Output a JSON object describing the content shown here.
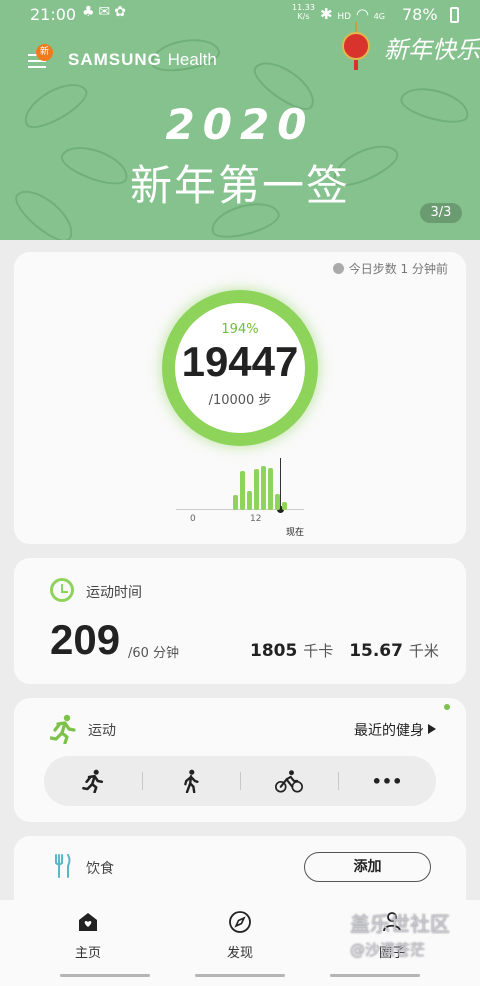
{
  "status": {
    "time": "21:00",
    "speed_top": "11.33",
    "speed_bottom": "K/s",
    "network": "HD",
    "signal": "4G",
    "battery": "78%"
  },
  "header": {
    "menu_badge": "新",
    "brand_bold": "SAMSUNG",
    "brand_light": "Health",
    "greeting": "新年快乐",
    "year": "2020",
    "headline": "新年第一签",
    "pager": "3/3"
  },
  "steps_card": {
    "sync_note": "今日步数 1 分钟前",
    "percent": "194%",
    "steps": "19447",
    "goal": "/10000 步",
    "axis_start": "0",
    "axis_mid": "12",
    "now_label": "现在",
    "hourly_steps_relative": [
      0.0,
      0.0,
      0.0,
      0.0,
      0.0,
      0.0,
      0.0,
      0.32,
      0.85,
      0.42,
      0.9,
      0.95,
      0.92,
      0.35,
      0.18
    ]
  },
  "exercise_card": {
    "title": "运动时间",
    "minutes": "209",
    "goal": "/60 分钟",
    "calories": "1805",
    "calories_unit": "千卡",
    "distance": "15.67",
    "distance_unit": "千米"
  },
  "activity_card": {
    "title": "运动",
    "recent_label": "最近的健身",
    "quick_items": [
      "run-icon",
      "walk-icon",
      "bike-icon",
      "more-icon"
    ],
    "more_label": "•••"
  },
  "food_card": {
    "title": "饮食",
    "add_label": "添加"
  },
  "bottom_nav": {
    "home": "主页",
    "discover": "发现",
    "community": "圈子"
  },
  "watermark": {
    "line1": "盖乐世社区",
    "line2": "@沙漠苍茫"
  },
  "colors": {
    "banner": "#86c28e",
    "accent_green": "#8ed35a",
    "badge_orange": "#f07b1d"
  }
}
